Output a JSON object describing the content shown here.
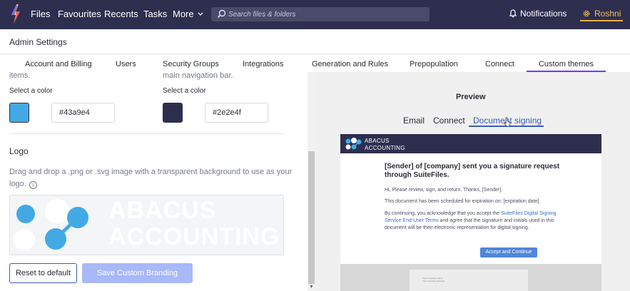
{
  "nav": {
    "items": [
      "Files",
      "Favourites",
      "Recents",
      "Tasks",
      "More"
    ],
    "search_placeholder": "Search files & folders",
    "notifications_label": "Notifications",
    "user_name": "Roshni"
  },
  "admin": {
    "title": "Admin Settings"
  },
  "tabs": {
    "items": [
      "Account and Billing",
      "Users",
      "Security Groups",
      "Integrations",
      "Generation and Rules",
      "Prepopulation",
      "Connect",
      "Custom themes"
    ],
    "active": "Custom themes"
  },
  "colors_section": {
    "left_partial_text": "items.",
    "right_partial_text": "main navigation bar.",
    "select_label": "Select a color",
    "primary_color": "#43a9e4",
    "secondary_color": "#2e2e4f"
  },
  "logo_section": {
    "heading": "Logo",
    "description": "Drag and drop a .png or .svg image with a transparent background to use as your logo.",
    "wordmark_line1": "ABACUS",
    "wordmark_line2": "ACCOUNTING"
  },
  "buttons": {
    "reset": "Reset to default",
    "save": "Save Custom Branding"
  },
  "preview": {
    "title": "Preview",
    "tabs": [
      "Email",
      "Connect",
      "Document signing"
    ],
    "active_tab": "Document signing",
    "email": {
      "logo_line1": "ABACUS",
      "logo_line2": "ACCOUNTING",
      "heading": "[Sender] of [company] sent you a signature request through SuiteFiles.",
      "line1": "Hi, Please review, sign, and return. Thanks, [Sender].",
      "line2": "This document has been scheduled for expiration on: [expiration date].",
      "line3_prefix": "By continuing, you acknowledge that you accept the ",
      "line3_link": "SuiteFiles Digital Signing Service End-User Terms",
      "line3_suffix": " and agree that the signature and initials used in this document will be their electronic representation for digital signing.",
      "button": "Accept and Continue",
      "doc_line1": "Your Company Name",
      "doc_line2": "Your Company Address"
    }
  },
  "theme": {
    "topbar": "#2e2e4f",
    "accent_user": "#e9b243",
    "link_blue": "#3c5cb8",
    "save_disabled": "#a8b8f8"
  }
}
